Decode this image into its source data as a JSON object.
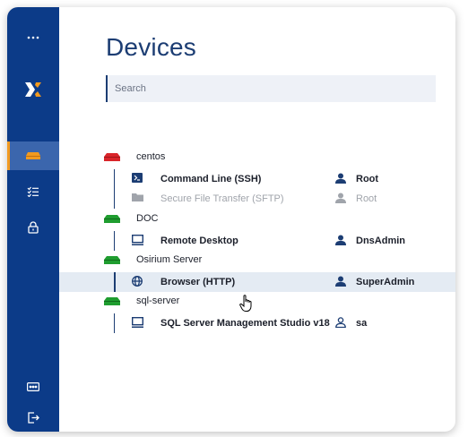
{
  "page": {
    "title": "Devices"
  },
  "search": {
    "placeholder": "Search",
    "value": ""
  },
  "sidebar": {
    "top_icon": "more-horizontal-icon",
    "logo": "x-logo",
    "items": [
      {
        "name": "devices",
        "icon": "server-icon",
        "active": true
      },
      {
        "name": "checklist",
        "icon": "checklist-icon",
        "active": false
      },
      {
        "name": "lock",
        "icon": "lock-icon",
        "active": false
      }
    ],
    "bottom_items": [
      {
        "name": "password",
        "icon": "password-field-icon"
      },
      {
        "name": "logout",
        "icon": "logout-icon"
      }
    ]
  },
  "colors": {
    "sidebar_bg": "#0c3b88",
    "accent": "#f29a1f",
    "server_down": "#d9252a",
    "server_up": "#1f9d2f",
    "title": "#1c3d73"
  },
  "servers": [
    {
      "name": "centos",
      "status": "down",
      "services": [
        {
          "name": "Command Line (SSH)",
          "icon": "terminal-icon",
          "user": "Root",
          "user_icon": "user-icon",
          "disabled": false
        },
        {
          "name": "Secure File Transfer (SFTP)",
          "icon": "folder-icon",
          "user": "Root",
          "user_icon": "user-icon",
          "disabled": true
        }
      ]
    },
    {
      "name": "DOC",
      "status": "up",
      "services": [
        {
          "name": "Remote Desktop",
          "icon": "monitor-icon",
          "user": "DnsAdmin",
          "user_icon": "user-icon",
          "disabled": false
        }
      ]
    },
    {
      "name": "Osirium Server",
      "status": "up",
      "services": [
        {
          "name": "Browser (HTTP)",
          "icon": "globe-icon",
          "user": "SuperAdmin",
          "user_icon": "user-icon",
          "disabled": false,
          "selected": true
        }
      ]
    },
    {
      "name": "sql-server",
      "status": "up",
      "services": [
        {
          "name": "SQL Server Management Studio v18",
          "icon": "monitor-icon",
          "user": "sa",
          "user_icon": "user-outline-icon",
          "disabled": false
        }
      ]
    }
  ]
}
